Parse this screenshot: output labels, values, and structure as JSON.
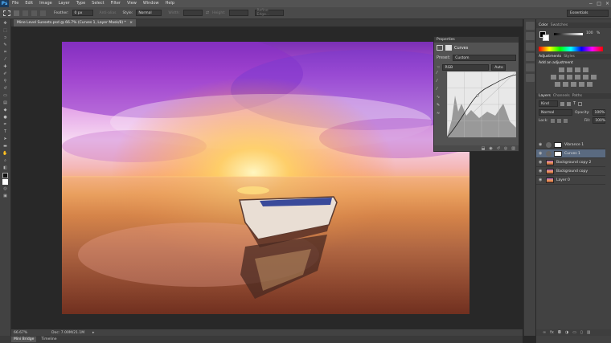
{
  "app": {
    "logo": "Ps"
  },
  "menu": {
    "items": [
      "File",
      "Edit",
      "Image",
      "Layer",
      "Type",
      "Select",
      "Filter",
      "View",
      "Window",
      "Help"
    ]
  },
  "options": {
    "feather_label": "Feather:",
    "feather_value": "0 px",
    "anti_alias_label": "Anti-alias",
    "style_label": "Style:",
    "style_value": "Normal",
    "width_label": "Width:",
    "height_label": "Height:",
    "refine_label": "Refine Edge..."
  },
  "workspace": {
    "value": "Essentials"
  },
  "document": {
    "tab_title": "Mine Level Sunsets.psd @ 66.7% (Curves 1, Layer Mask/8) *",
    "zoom": "66.67%",
    "doc_info": "Doc: 7.00M/21.1M"
  },
  "bottom_tabs": [
    "Mini Bridge",
    "Timeline"
  ],
  "properties": {
    "title": "Properties",
    "panel_name": "Curves",
    "preset_label": "Preset:",
    "preset_value": "Custom",
    "channel_value": "RGB",
    "auto_label": "Auto"
  },
  "color_panel": {
    "tabs": [
      "Color",
      "Swatches"
    ],
    "value": "100",
    "unit": "%"
  },
  "adjustments_panel": {
    "tabs": [
      "Adjustments",
      "Styles"
    ],
    "heading": "Add an adjustment"
  },
  "layers_panel": {
    "tabs": [
      "Layers",
      "Channels",
      "Paths"
    ],
    "kind_label": "Kind",
    "blend_mode": "Normal",
    "opacity_label": "Opacity:",
    "opacity_value": "100%",
    "lock_label": "Lock:",
    "fill_label": "Fill:",
    "fill_value": "100%",
    "layers": [
      {
        "name": "Vibrance 1"
      },
      {
        "name": "Curves 1"
      },
      {
        "name": "Background copy 2"
      },
      {
        "name": "Background copy"
      },
      {
        "name": "Layer 0"
      }
    ]
  },
  "colors": {
    "accent": "#4fb2ff",
    "panel": "#535353",
    "dark": "#282828"
  }
}
